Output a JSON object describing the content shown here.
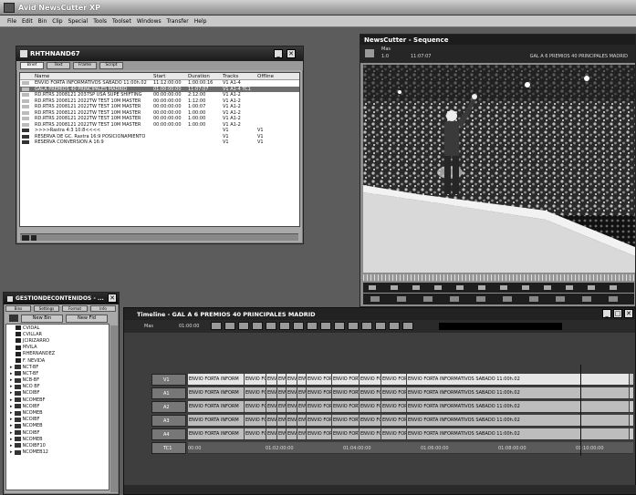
{
  "app": {
    "title": "Avid NewsCutter XP"
  },
  "menu": [
    "File",
    "Edit",
    "Bin",
    "Clip",
    "Special",
    "Tools",
    "Toolset",
    "Windows",
    "Transfer",
    "Help"
  ],
  "bin": {
    "title": "RHTHNAND67",
    "tabs": [
      "Brief",
      "Text",
      "Frame",
      "Script"
    ],
    "columns": [
      "Name",
      "Start",
      "Duration",
      "Tracks",
      "Offline"
    ],
    "rows": [
      {
        "name": "ENVIO FORTA INFORMATIVOS SABADO 11:00h.02",
        "start": "11:12:00:00",
        "duration": "1:00:00:16",
        "tracks": "V1 A1-4",
        "offline": ""
      },
      {
        "name": "GALA PREMIOS 40 PRINCIPALES MADRID",
        "start": "01:00:00:00",
        "duration": "11:07:07",
        "tracks": "V1 A1-4 TC1",
        "offline": ""
      },
      {
        "name": "RD.RTRS 2008121 2037SP USA SUPE SHIFTING",
        "start": "00:00:00:00",
        "duration": "2:12:00",
        "tracks": "V1 A1-2",
        "offline": ""
      },
      {
        "name": "RD.RTRS 2008121 2022TW TEST 10M MASTER",
        "start": "00:00:00:00",
        "duration": "1:12:00",
        "tracks": "V1 A1-2",
        "offline": ""
      },
      {
        "name": "RD.RTRS 2008121 2022TW TEST 10M MASTER",
        "start": "00:00:00:00",
        "duration": "1:00:07",
        "tracks": "V1 A1-2",
        "offline": ""
      },
      {
        "name": "RD.RTRS 2008121 2022TW TEST 10M MASTER",
        "start": "00:00:00:00",
        "duration": "1:00:00",
        "tracks": "V1 A1-2",
        "offline": ""
      },
      {
        "name": "RD.RTRS 2008121 2022TW TEST 10M MASTER",
        "start": "00:00:00:00",
        "duration": "1:00:00",
        "tracks": "V1 A1-2",
        "offline": ""
      },
      {
        "name": "RD.RTRS 2008121 2022TW TEST 10M MASTER",
        "start": "00:00:00:00",
        "duration": "1:00:00",
        "tracks": "V1 A1-2",
        "offline": ""
      },
      {
        "name": ">>>>Rastra 4:3 10:8<<<<",
        "start": "",
        "duration": "",
        "tracks": "V1",
        "offline": "V1"
      },
      {
        "name": "RESERVA DE GC. Rastra 16:9 POSICIONAMIENTO",
        "start": "",
        "duration": "",
        "tracks": "V1",
        "offline": "V1"
      },
      {
        "name": "RESERVA CONVERSION A 16:9",
        "start": "",
        "duration": "",
        "tracks": "V1",
        "offline": "V1"
      }
    ]
  },
  "viewer": {
    "title": "NewsCutter - Sequence",
    "tc_label": "Mas",
    "tc_value": "11:07:07",
    "tc_small": "1:0",
    "seq_name": "GAL A 6 PREMIOS 40 PRINCIPALES MADRID"
  },
  "project": {
    "title": "GESTIONDECONTENIDOS - ...",
    "tabs": [
      "Bins",
      "Settings",
      "Format",
      "Info"
    ],
    "buttons": [
      "New Bin",
      "New Fld"
    ],
    "items": [
      {
        "label": "CVIDAL",
        "type": "bin"
      },
      {
        "label": "CVILLAR",
        "type": "bin"
      },
      {
        "label": "JCIRIZARRO",
        "type": "bin"
      },
      {
        "label": "MVILA",
        "type": "bin"
      },
      {
        "label": "RHERNANDEZ",
        "type": "bin"
      },
      {
        "label": "F. NEVIDA",
        "type": "bin"
      },
      {
        "label": "NCT-BF",
        "type": "folder"
      },
      {
        "label": "NCT-BF",
        "type": "folder"
      },
      {
        "label": "NCB-BF",
        "type": "folder"
      },
      {
        "label": "NCO BF",
        "type": "folder"
      },
      {
        "label": "NCOIBF",
        "type": "folder"
      },
      {
        "label": "NCOMEBF",
        "type": "folder"
      },
      {
        "label": "NCOIBF",
        "type": "folder"
      },
      {
        "label": "NCOMEB",
        "type": "folder"
      },
      {
        "label": "NCOIBF",
        "type": "folder"
      },
      {
        "label": "NCOMEB",
        "type": "folder"
      },
      {
        "label": "NCOIBF",
        "type": "folder"
      },
      {
        "label": "NCOMEB",
        "type": "folder"
      },
      {
        "label": "NCOIBF10",
        "type": "folder"
      },
      {
        "label": "NCOMEB12",
        "type": "folder"
      }
    ]
  },
  "timeline": {
    "title": "Timeline - GAL A 6 PREMIOS 40 PRINCIPALES MADRID",
    "tc": "01:00:00",
    "tc_label": "Mas",
    "tracks": [
      "V1",
      "A1",
      "A2",
      "A3",
      "A4",
      "TC1"
    ],
    "clip_long": "ENVIO FORTA INFORMATIVOS SABADO 11:00h.02",
    "clip_short": "ENVIO FORTA INFORM",
    "clip_tiny": "ENVIO",
    "clip_audio": "ENVIO FORTA INFORMATIVOS SABADO 11:00h.02",
    "ruler": [
      "00:00",
      "01:02:00:00",
      "01:04:00:00",
      "01:06:00:00",
      "01:08:00:00",
      "01:10:00:00"
    ]
  },
  "colors": {
    "desk": "#5c5c5c",
    "panel": "#a9a9a9",
    "title": "#111111"
  }
}
